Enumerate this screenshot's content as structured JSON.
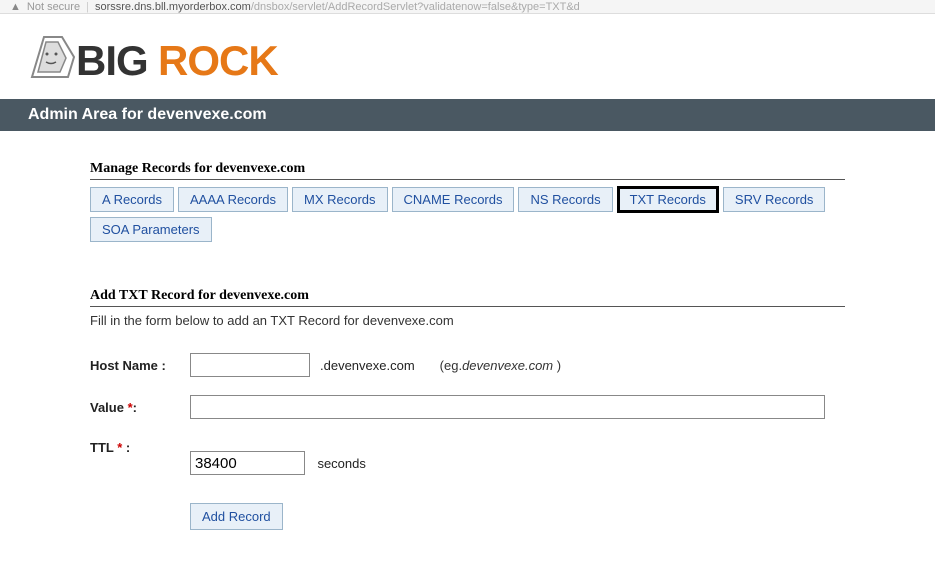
{
  "url_bar": {
    "security_label": "Not secure",
    "url_prefix": "sorssre.dns.bll.myorderbox.com",
    "url_path": "/dnsbox/servlet/AddRecordServlet?validatenow=false&type=TXT&d"
  },
  "logo": {
    "text1": "BIG",
    "text2": "ROCK"
  },
  "title": "Admin Area for devenvexe.com",
  "manage_header": "Manage Records for devenvexe.com",
  "tabs": [
    {
      "label": "A Records",
      "active": false
    },
    {
      "label": "AAAA Records",
      "active": false
    },
    {
      "label": "MX Records",
      "active": false
    },
    {
      "label": "CNAME Records",
      "active": false
    },
    {
      "label": "NS Records",
      "active": false
    },
    {
      "label": "TXT Records",
      "active": true
    },
    {
      "label": "SRV Records",
      "active": false
    },
    {
      "label": "SOA Parameters",
      "active": false
    }
  ],
  "add_header": "Add TXT Record for devenvexe.com",
  "instruction": "Fill in the form below to add an TXT Record for devenvexe.com",
  "form": {
    "hostname_label": "Host Name",
    "hostname_value": "",
    "hostname_suffix": ".devenvexe.com",
    "hostname_example_prefix": "(eg.",
    "hostname_example_domain": "devenvexe.com",
    "hostname_example_suffix": " )",
    "value_label": "Value",
    "value_value": "",
    "ttl_label": "TTL",
    "ttl_value": "38400",
    "ttl_unit": "seconds",
    "submit_label": "Add Record"
  }
}
